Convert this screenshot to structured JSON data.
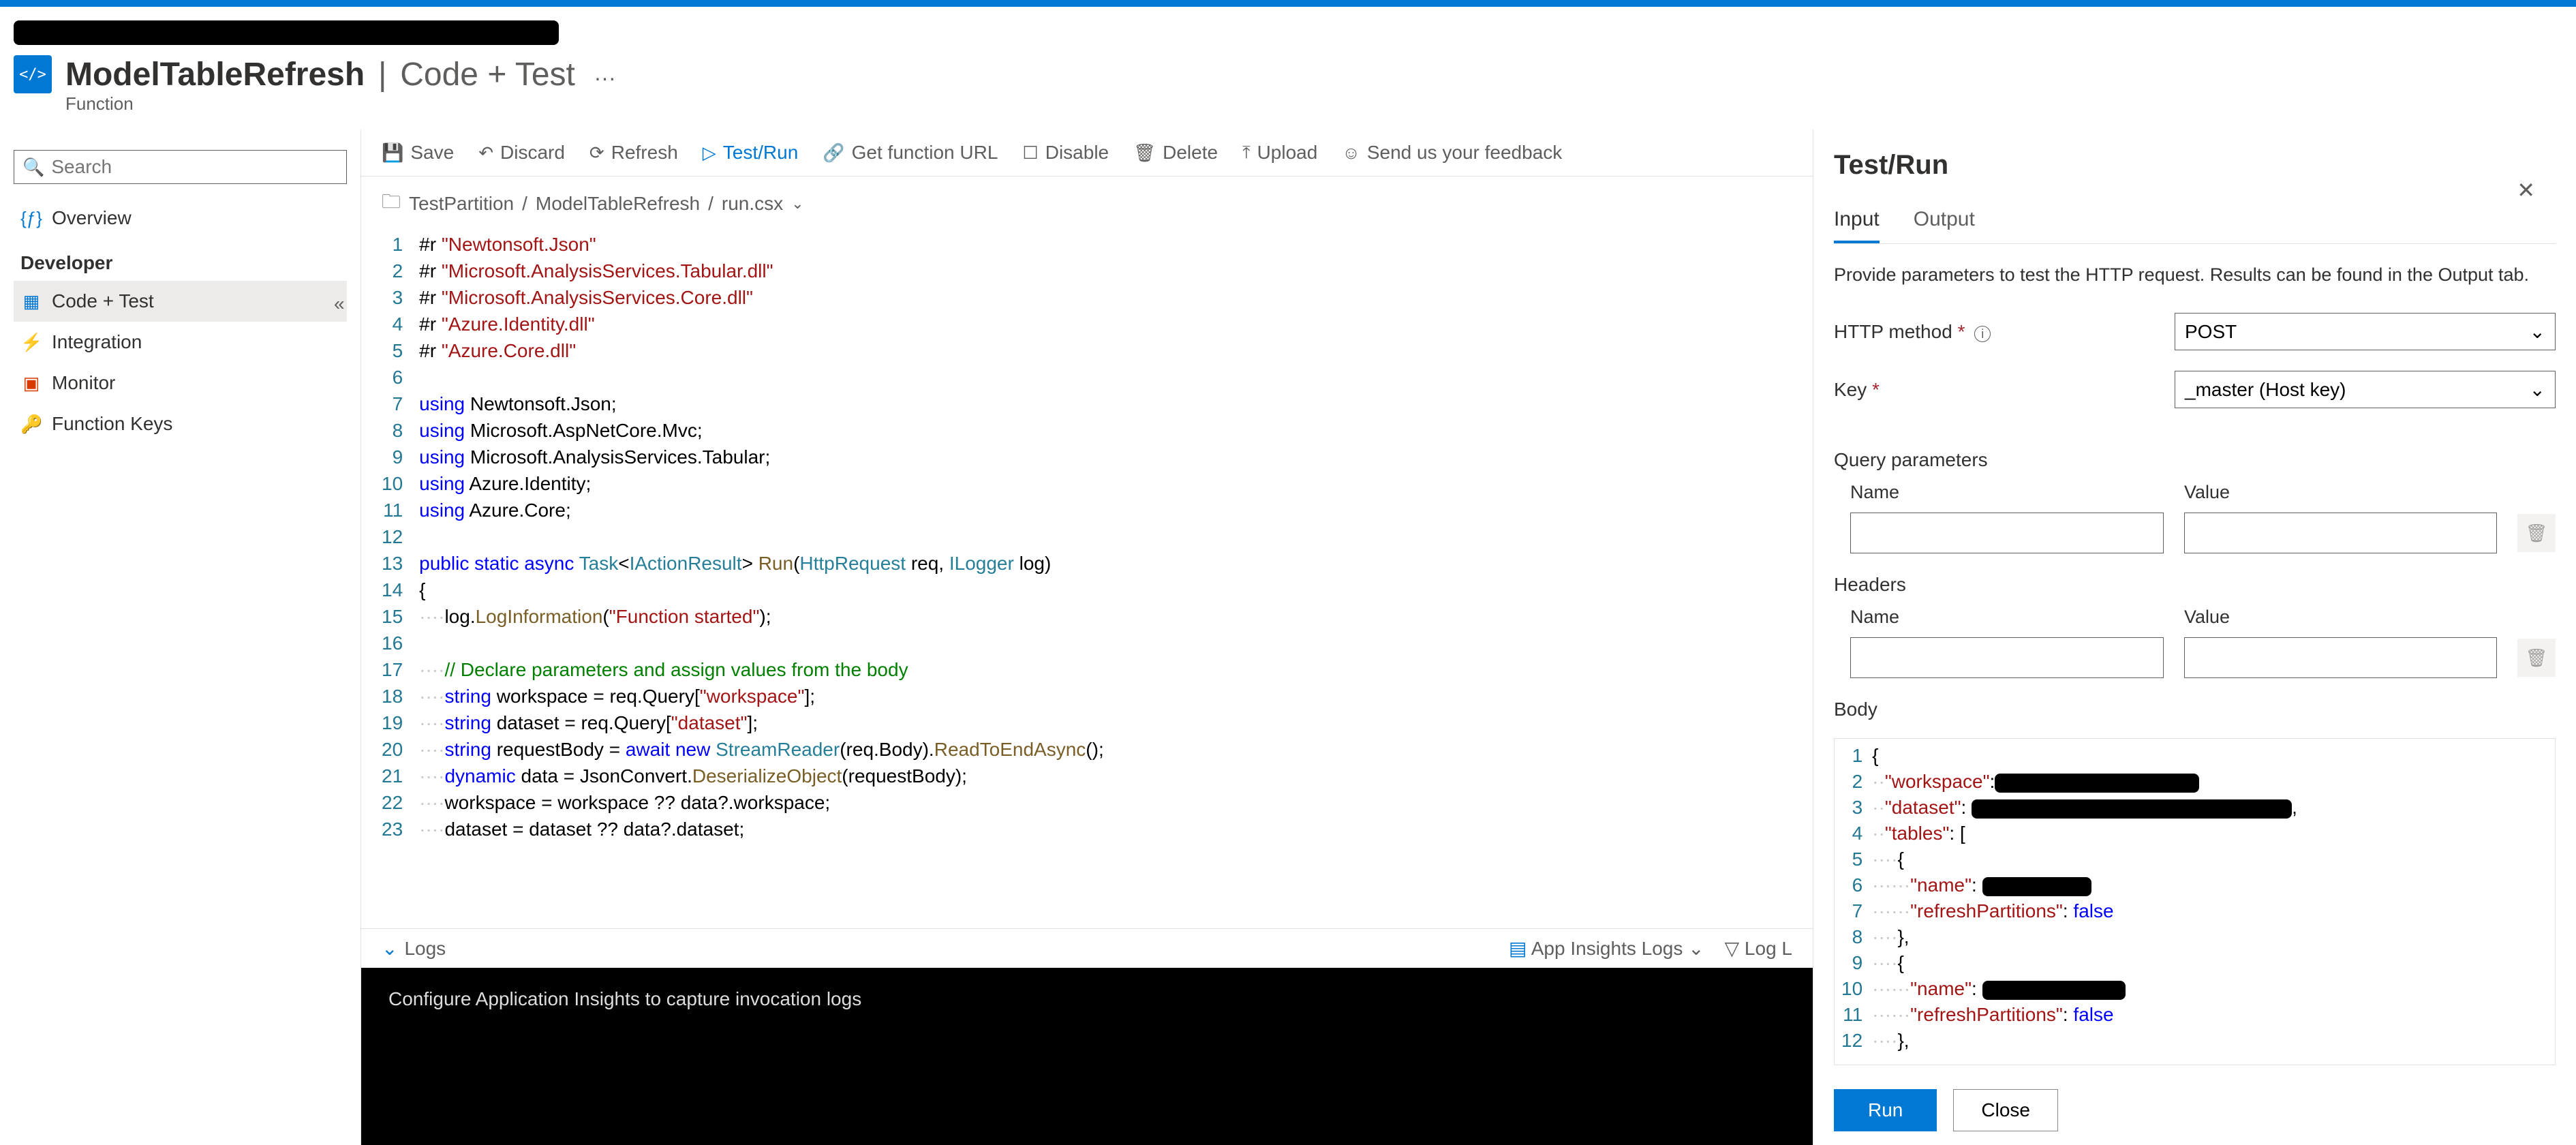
{
  "header": {
    "function_name": "ModelTableRefresh",
    "page": "Code + Test",
    "subtitle": "Function"
  },
  "sidebar": {
    "search_placeholder": "Search",
    "items": [
      {
        "icon": "overview",
        "label": "Overview"
      }
    ],
    "section": "Developer",
    "dev_items": [
      {
        "icon": "code",
        "label": "Code + Test",
        "selected": true
      },
      {
        "icon": "bolt",
        "label": "Integration"
      },
      {
        "icon": "monitor",
        "label": "Monitor"
      },
      {
        "icon": "key",
        "label": "Function Keys"
      }
    ]
  },
  "toolbar": {
    "save": "Save",
    "discard": "Discard",
    "refresh": "Refresh",
    "testrun": "Test/Run",
    "geturl": "Get function URL",
    "disable": "Disable",
    "delete": "Delete",
    "upload": "Upload",
    "feedback": "Send us your feedback"
  },
  "breadcrumb": {
    "a": "TestPartition",
    "b": "ModelTableRefresh",
    "c": "run.csx"
  },
  "code_lines": [
    [
      [
        "dir",
        "#r "
      ],
      [
        "str",
        "\"Newtonsoft.Json\""
      ]
    ],
    [
      [
        "dir",
        "#r "
      ],
      [
        "str",
        "\"Microsoft.AnalysisServices.Tabular.dll\""
      ]
    ],
    [
      [
        "dir",
        "#r "
      ],
      [
        "str",
        "\"Microsoft.AnalysisServices.Core.dll\""
      ]
    ],
    [
      [
        "dir",
        "#r "
      ],
      [
        "str",
        "\"Azure.Identity.dll\""
      ]
    ],
    [
      [
        "dir",
        "#r "
      ],
      [
        "str",
        "\"Azure.Core.dll\""
      ]
    ],
    [],
    [
      [
        "kw",
        "using"
      ],
      [
        "",
        " Newtonsoft.Json;"
      ]
    ],
    [
      [
        "kw",
        "using"
      ],
      [
        "",
        " Microsoft.AspNetCore.Mvc;"
      ]
    ],
    [
      [
        "kw",
        "using"
      ],
      [
        "",
        " Microsoft.AnalysisServices.Tabular;"
      ]
    ],
    [
      [
        "kw",
        "using"
      ],
      [
        "",
        " Azure.Identity;"
      ]
    ],
    [
      [
        "kw",
        "using"
      ],
      [
        "",
        " Azure.Core;"
      ]
    ],
    [],
    [
      [
        "kw",
        "public static async"
      ],
      [
        "",
        " "
      ],
      [
        "type",
        "Task"
      ],
      [
        "",
        "<"
      ],
      [
        "type",
        "IActionResult"
      ],
      [
        "",
        "> "
      ],
      [
        "fn",
        "Run"
      ],
      [
        "",
        "("
      ],
      [
        "type",
        "HttpRequest"
      ],
      [
        "",
        " req, "
      ],
      [
        "type",
        "ILogger"
      ],
      [
        "",
        " log)"
      ]
    ],
    [
      [
        "",
        "{"
      ]
    ],
    [
      [
        "lead",
        "····"
      ],
      [
        "",
        "log."
      ],
      [
        "fn",
        "LogInformation"
      ],
      [
        "",
        "("
      ],
      [
        "str",
        "\"Function started\""
      ],
      [
        "",
        ");"
      ]
    ],
    [],
    [
      [
        "lead",
        "····"
      ],
      [
        "cm",
        "// Declare parameters and assign values from the body"
      ]
    ],
    [
      [
        "lead",
        "····"
      ],
      [
        "kw",
        "string"
      ],
      [
        "",
        " workspace = req.Query["
      ],
      [
        "str",
        "\"workspace\""
      ],
      [
        "",
        "];"
      ]
    ],
    [
      [
        "lead",
        "····"
      ],
      [
        "kw",
        "string"
      ],
      [
        "",
        " dataset = req.Query["
      ],
      [
        "str",
        "\"dataset\""
      ],
      [
        "",
        "];"
      ]
    ],
    [
      [
        "lead",
        "····"
      ],
      [
        "kw",
        "string"
      ],
      [
        "",
        " requestBody = "
      ],
      [
        "kw",
        "await new"
      ],
      [
        "",
        " "
      ],
      [
        "type",
        "StreamReader"
      ],
      [
        "",
        "(req.Body)."
      ],
      [
        "fn",
        "ReadToEndAsync"
      ],
      [
        "",
        "();"
      ]
    ],
    [
      [
        "lead",
        "····"
      ],
      [
        "kw",
        "dynamic"
      ],
      [
        "",
        " data = JsonConvert."
      ],
      [
        "fn",
        "DeserializeObject"
      ],
      [
        "",
        "(requestBody);"
      ]
    ],
    [
      [
        "lead",
        "····"
      ],
      [
        "",
        "workspace = workspace ?? data?.workspace;"
      ]
    ],
    [
      [
        "lead",
        "····"
      ],
      [
        "",
        "dataset = dataset ?? data?.dataset;"
      ]
    ]
  ],
  "logs": {
    "toggle": "Logs",
    "insights": "App Insights Logs",
    "filter": "Log L",
    "console": "Configure Application Insights to capture invocation logs"
  },
  "panel": {
    "title": "Test/Run",
    "tabs": {
      "input": "Input",
      "output": "Output"
    },
    "desc": "Provide parameters to test the HTTP request. Results can be found in the Output tab.",
    "http_method_label": "HTTP method",
    "http_method_value": "POST",
    "key_label": "Key",
    "key_value": "_master (Host key)",
    "query_h": "Query parameters",
    "headers_h": "Headers",
    "col_name": "Name",
    "col_value": "Value",
    "body_label": "Body",
    "body_lines": [
      [
        [
          "",
          "{"
        ]
      ],
      [
        [
          "lead",
          "··"
        ],
        [
          "str",
          "\"workspace\""
        ],
        [
          "",
          ":"
        ],
        [
          "redact",
          "300"
        ]
      ],
      [
        [
          "lead",
          "··"
        ],
        [
          "str",
          "\"dataset\""
        ],
        [
          "",
          ": "
        ],
        [
          "redact",
          "470"
        ],
        [
          "",
          ","
        ]
      ],
      [
        [
          "lead",
          "··"
        ],
        [
          "str",
          "\"tables\""
        ],
        [
          "",
          ": ["
        ]
      ],
      [
        [
          "lead",
          "····"
        ],
        [
          "",
          "{"
        ]
      ],
      [
        [
          "lead",
          "······"
        ],
        [
          "str",
          "\"name\""
        ],
        [
          "",
          ": "
        ],
        [
          "redact",
          "160"
        ]
      ],
      [
        [
          "lead",
          "······"
        ],
        [
          "str",
          "\"refreshPartitions\""
        ],
        [
          "",
          ": "
        ],
        [
          "kw",
          "false"
        ]
      ],
      [
        [
          "lead",
          "····"
        ],
        [
          "",
          "},"
        ]
      ],
      [
        [
          "lead",
          "····"
        ],
        [
          "",
          "{"
        ]
      ],
      [
        [
          "lead",
          "······"
        ],
        [
          "str",
          "\"name\""
        ],
        [
          "",
          ": "
        ],
        [
          "redact",
          "210"
        ]
      ],
      [
        [
          "lead",
          "······"
        ],
        [
          "str",
          "\"refreshPartitions\""
        ],
        [
          "",
          ": "
        ],
        [
          "kw",
          "false"
        ]
      ],
      [
        [
          "lead",
          "····"
        ],
        [
          "",
          "},"
        ]
      ]
    ],
    "run": "Run",
    "close": "Close"
  }
}
